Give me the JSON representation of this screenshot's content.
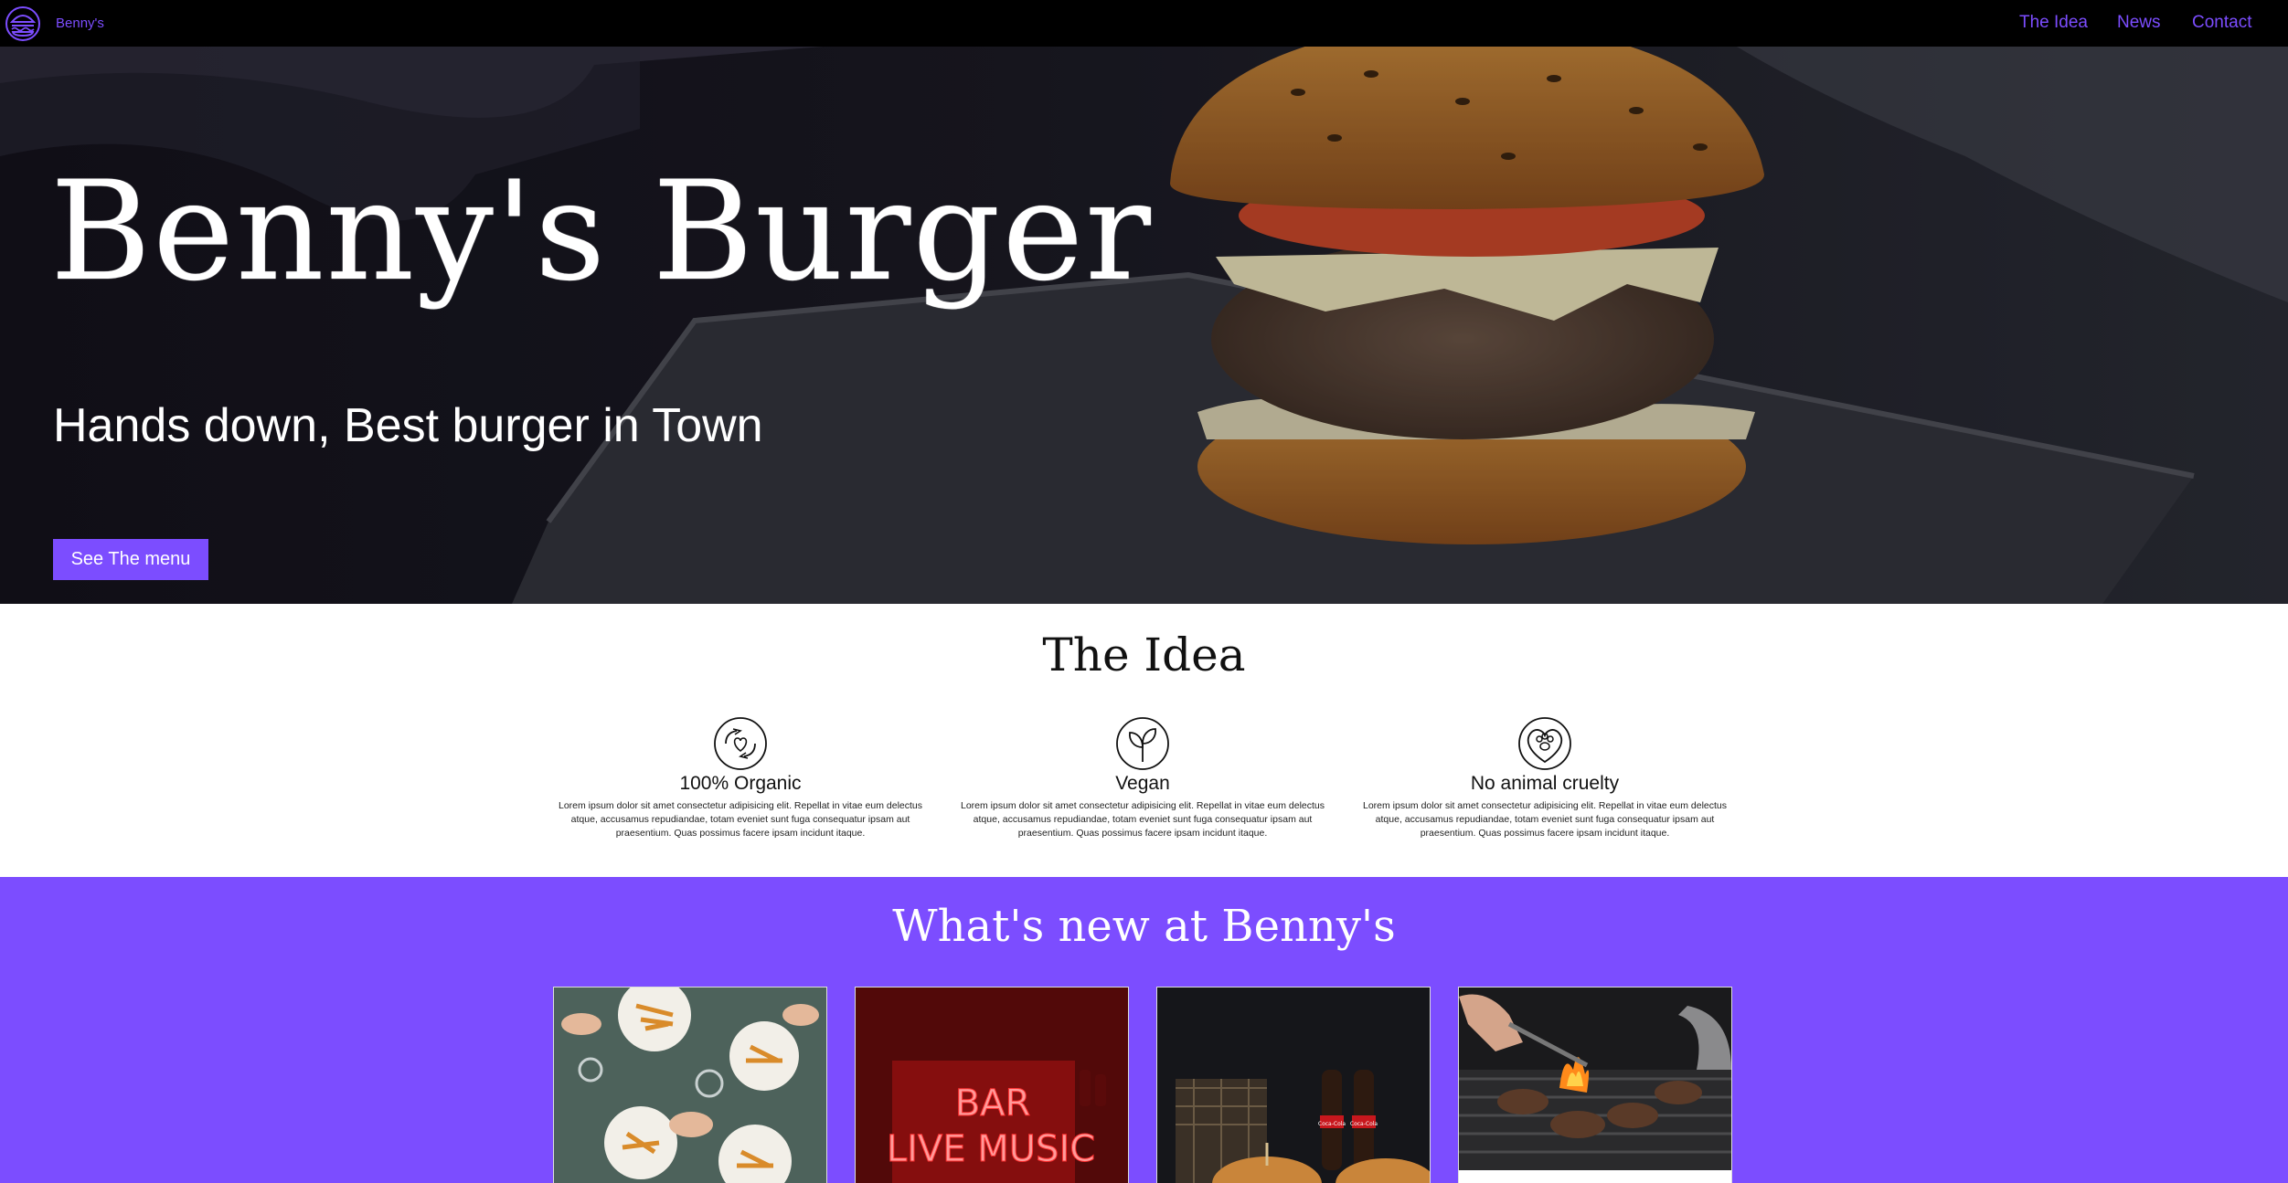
{
  "nav": {
    "brand": "Benny's",
    "links": [
      {
        "label": "The Idea"
      },
      {
        "label": "News"
      },
      {
        "label": "Contact"
      }
    ]
  },
  "hero": {
    "title": "Benny's Burger",
    "subtitle": "Hands down, Best burger in Town",
    "button_label": "See The menu"
  },
  "idea": {
    "title": "The Idea",
    "features": [
      {
        "icon": "organic-hands-heart-icon",
        "title": "100% Organic",
        "desc": "Lorem ipsum dolor sit amet consectetur adipisicing elit. Repellat in vitae eum delectus atque, accusamus repudiandae, totam eveniet sunt fuga consequatur ipsam aut praesentium. Quas possimus facere ipsam incidunt itaque."
      },
      {
        "icon": "vegan-sprout-icon",
        "title": "Vegan",
        "desc": "Lorem ipsum dolor sit amet consectetur adipisicing elit. Repellat in vitae eum delectus atque, accusamus repudiandae, totam eveniet sunt fuga consequatur ipsam aut praesentium. Quas possimus facere ipsam incidunt itaque."
      },
      {
        "icon": "paw-heart-icon",
        "title": "No animal cruelty",
        "desc": "Lorem ipsum dolor sit amet consectetur adipisicing elit. Repellat in vitae eum delectus atque, accusamus repudiandae, totam eveniet sunt fuga consequatur ipsam aut praesentium. Quas possimus facere ipsam incidunt itaque."
      }
    ]
  },
  "news": {
    "title": "What's new at Benny's",
    "cards": [
      {
        "image": "friends-dining-fries-photo"
      },
      {
        "image": "bar-live-music-neon-photo",
        "neon_line1": "BAR",
        "neon_line2": "LIVE MUSIC"
      },
      {
        "image": "burgers-and-cola-photo",
        "bottle_label": "Coca-Cola"
      },
      {
        "image": "grill-patties-photo",
        "caption": "..."
      }
    ]
  },
  "colors": {
    "accent": "#7c4dff",
    "nav_bg": "#000000",
    "section_bg": "#ffffff"
  }
}
